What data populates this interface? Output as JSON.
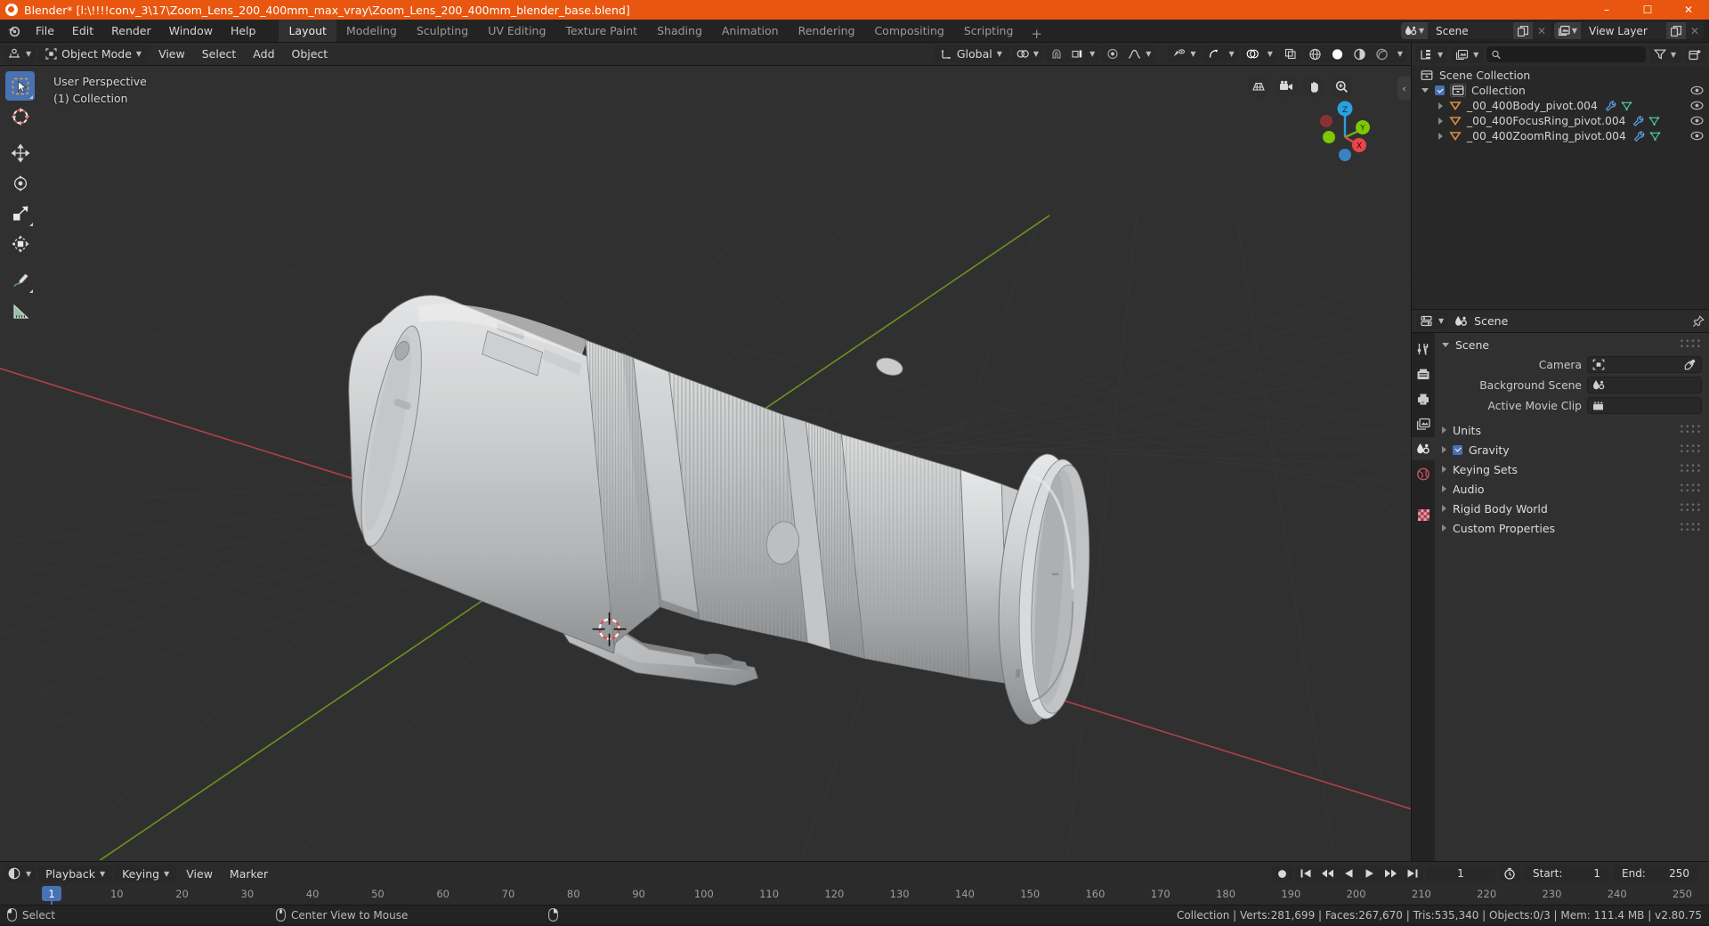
{
  "window": {
    "title": "Blender* [l:\\!!!!conv_3\\17\\Zoom_Lens_200_400mm_max_vray\\Zoom_Lens_200_400mm_blender_base.blend]",
    "minimize": "–",
    "maximize": "☐",
    "close": "✕"
  },
  "topbar": {
    "menus": [
      "File",
      "Edit",
      "Render",
      "Window",
      "Help"
    ],
    "workspace_tabs": [
      {
        "label": "Layout",
        "active": true
      },
      {
        "label": "Modeling",
        "active": false
      },
      {
        "label": "Sculpting",
        "active": false
      },
      {
        "label": "UV Editing",
        "active": false
      },
      {
        "label": "Texture Paint",
        "active": false
      },
      {
        "label": "Shading",
        "active": false
      },
      {
        "label": "Animation",
        "active": false
      },
      {
        "label": "Rendering",
        "active": false
      },
      {
        "label": "Compositing",
        "active": false
      },
      {
        "label": "Scripting",
        "active": false
      }
    ],
    "add_workspace": "+",
    "scene_name": "Scene",
    "view_layer_name": "View Layer"
  },
  "viewport": {
    "header": {
      "mode": "Object Mode",
      "menus": [
        "View",
        "Select",
        "Add",
        "Object"
      ],
      "transform_orientation": "Global"
    },
    "overlay": {
      "perspective": "User Perspective",
      "collection": "(1) Collection"
    },
    "gizmo": {
      "axis_z": "Z",
      "axis_y": "Y",
      "axis_x": "X"
    },
    "tools": [
      {
        "name": "select-box-tool",
        "selected": true
      },
      {
        "name": "cursor-tool",
        "selected": false
      },
      {
        "name": "move-tool",
        "selected": false
      },
      {
        "name": "rotate-tool",
        "selected": false
      },
      {
        "name": "scale-tool",
        "selected": false
      },
      {
        "name": "transform-tool",
        "selected": false
      },
      {
        "name": "annotate-tool",
        "selected": false
      },
      {
        "name": "measure-tool",
        "selected": false
      }
    ]
  },
  "outliner": {
    "search_placeholder": "",
    "search_value": "",
    "rows": [
      {
        "label": "Scene Collection",
        "depth": 0,
        "icon": "collection-icon",
        "expander": "none",
        "checkbox": false,
        "eye": false,
        "modifiers": []
      },
      {
        "label": "Collection",
        "depth": 1,
        "icon": "collection-icon",
        "expander": "down",
        "checkbox": true,
        "eye": true,
        "modifiers": []
      },
      {
        "label": "_00_400Body_pivot.004",
        "depth": 2,
        "icon": "empty-icon",
        "expander": "right",
        "checkbox": false,
        "eye": true,
        "modifiers": [
          "wrench-icon",
          "mesh-data-icon"
        ]
      },
      {
        "label": "_00_400FocusRing_pivot.004",
        "depth": 2,
        "icon": "empty-icon",
        "expander": "right",
        "checkbox": false,
        "eye": true,
        "modifiers": [
          "wrench-icon",
          "mesh-data-icon"
        ]
      },
      {
        "label": "_00_400ZoomRing_pivot.004",
        "depth": 2,
        "icon": "empty-icon",
        "expander": "right",
        "checkbox": false,
        "eye": true,
        "modifiers": [
          "wrench-icon",
          "mesh-data-icon"
        ]
      }
    ]
  },
  "properties": {
    "breadcrumb": "Scene",
    "tabs": [
      {
        "name": "tool-tab",
        "active": false
      },
      {
        "name": "render-tab",
        "active": false
      },
      {
        "name": "output-tab",
        "active": false
      },
      {
        "name": "view-layer-tab",
        "active": false
      },
      {
        "name": "scene-tab",
        "active": true
      },
      {
        "name": "world-tab",
        "active": false
      },
      {
        "name": "texture-tab",
        "active": false
      }
    ],
    "panels": [
      {
        "label": "Scene",
        "expanded": true,
        "checkbox": null
      },
      {
        "label": "Units",
        "expanded": false,
        "checkbox": null
      },
      {
        "label": "Gravity",
        "expanded": false,
        "checkbox": true
      },
      {
        "label": "Keying Sets",
        "expanded": false,
        "checkbox": null
      },
      {
        "label": "Audio",
        "expanded": false,
        "checkbox": null
      },
      {
        "label": "Rigid Body World",
        "expanded": false,
        "checkbox": null
      },
      {
        "label": "Custom Properties",
        "expanded": false,
        "checkbox": null
      }
    ],
    "scene_fields": [
      {
        "label": "Camera",
        "value": "",
        "icon": "camera-icon",
        "eyedropper": true
      },
      {
        "label": "Background Scene",
        "value": "",
        "icon": "scene-icon",
        "eyedropper": false
      },
      {
        "label": "Active Movie Clip",
        "value": "",
        "icon": "clip-icon",
        "eyedropper": false
      }
    ]
  },
  "timeline": {
    "menus": [
      "Playback",
      "Keying",
      "View",
      "Marker"
    ],
    "current_frame": "1",
    "start_label": "Start:",
    "start_value": "1",
    "end_label": "End:",
    "end_value": "250",
    "ticks": [
      "1",
      "10",
      "20",
      "30",
      "40",
      "50",
      "60",
      "70",
      "80",
      "90",
      "100",
      "110",
      "120",
      "130",
      "140",
      "150",
      "160",
      "170",
      "180",
      "190",
      "200",
      "210",
      "220",
      "230",
      "240",
      "250"
    ],
    "playhead_frame": "1"
  },
  "statusbar": {
    "hints": [
      {
        "icon": "mouse-left-icon",
        "label": "Select"
      },
      {
        "icon": "mouse-middle-icon",
        "label": "Center View to Mouse"
      },
      {
        "icon": "mouse-right-icon",
        "label": ""
      }
    ],
    "stats": "Collection | Verts:281,699 | Faces:267,670 | Tris:535,340 | Objects:0/3 | Mem: 111.4 MB | v2.80.75"
  },
  "colors": {
    "accent_blue": "#4772b3",
    "title_orange": "#e8560f",
    "viewport_bg": "#303030",
    "axis_x_red": "#c8404a",
    "axis_y_green": "#7aa81e",
    "object_grey": "#c9cacb"
  }
}
